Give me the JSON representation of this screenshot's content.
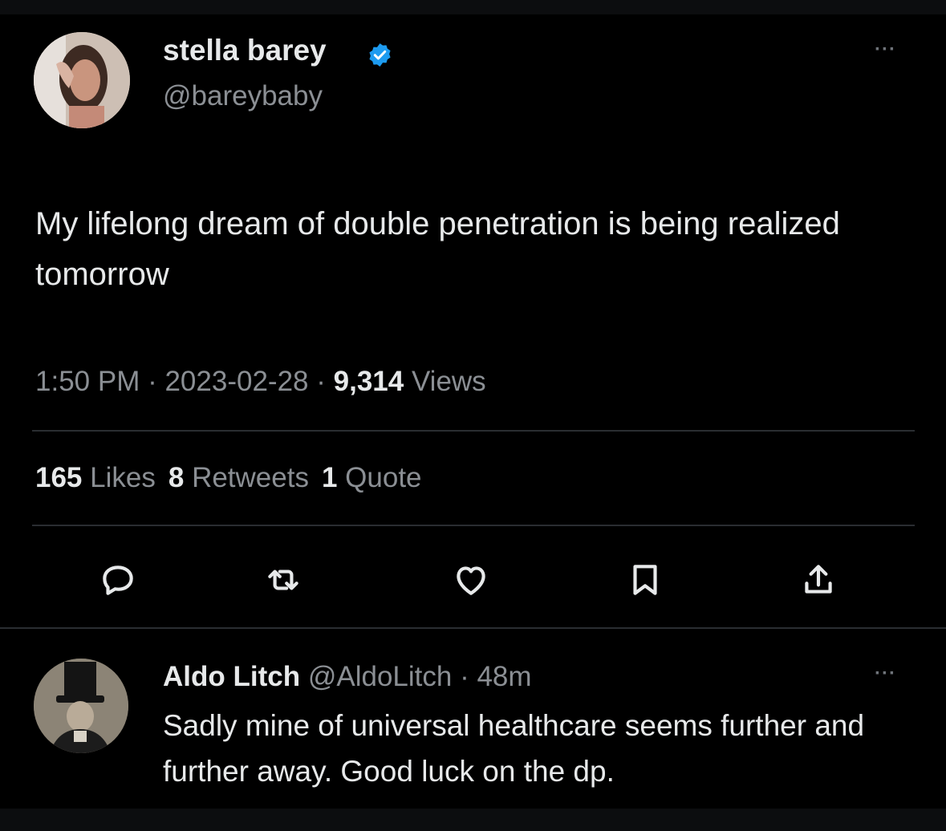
{
  "tweet": {
    "author_name": "stella barey",
    "author_handle": "@bareybaby",
    "text": "My lifelong dream of double penetration is being realized tomorrow",
    "time": "1:50 PM",
    "date": "2023-02-28",
    "views_count": "9,314",
    "views_label": "Views",
    "likes_count": "165",
    "likes_label": "Likes",
    "retweets_count": "8",
    "retweets_label": "Retweets",
    "quotes_count": "1",
    "quotes_label": "Quote",
    "more_label": "···",
    "separator": " · "
  },
  "actions": {
    "reply_icon": "reply-icon",
    "retweet_icon": "retweet-icon",
    "like_icon": "heart-icon",
    "bookmark_icon": "bookmark-icon",
    "share_icon": "share-icon"
  },
  "reply": {
    "author_name": "Aldo Litch",
    "author_handle": "@AldoLitch",
    "age": "48m",
    "separator": " · ",
    "text": "Sadly mine of universal healthcare seems further and further away. Good luck on the dp.",
    "more_label": "···"
  },
  "colors": {
    "background": "#000000",
    "text_primary": "#e7e9ea",
    "text_secondary": "#8b8f94",
    "verified_badge": "#1d9bf0",
    "divider": "#2a2d31"
  }
}
